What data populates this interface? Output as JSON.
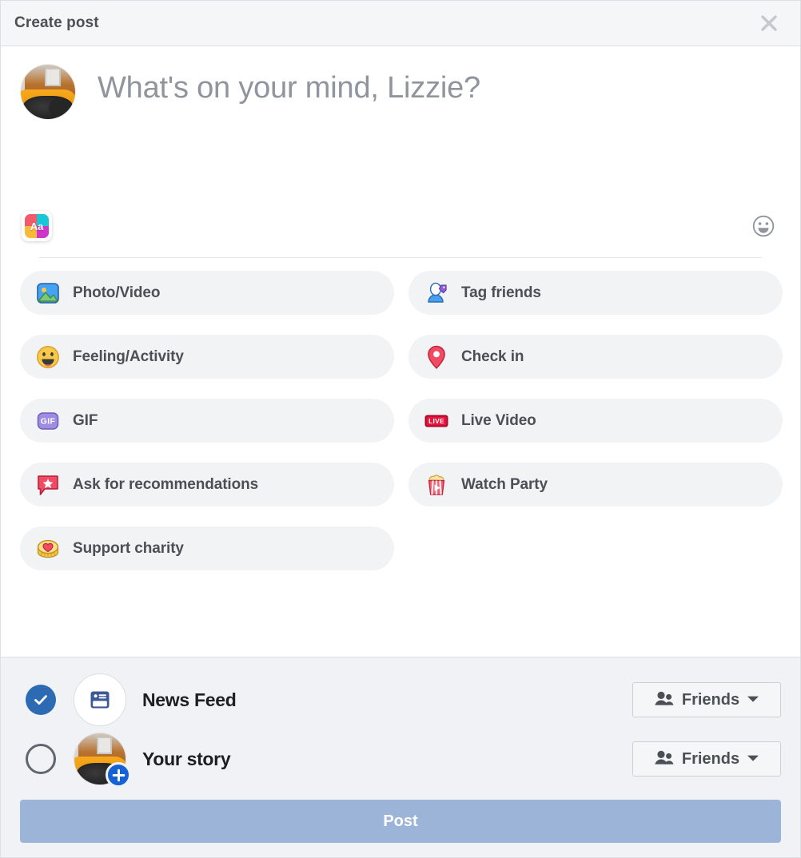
{
  "header": {
    "title": "Create post",
    "close_icon": "close-icon"
  },
  "composer": {
    "placeholder": "What's on your mind, Lizzie?",
    "avatar_alt": "user-avatar",
    "background_picker": {
      "icon": "aa-background-icon",
      "label": "Aa"
    },
    "emoji_button_icon": "smiley-face-icon"
  },
  "options": [
    {
      "id": "photo-video",
      "label": "Photo/Video",
      "icon": "photo-video-icon"
    },
    {
      "id": "tag-friends",
      "label": "Tag friends",
      "icon": "tag-friends-icon"
    },
    {
      "id": "feeling-activity",
      "label": "Feeling/Activity",
      "icon": "feeling-activity-icon"
    },
    {
      "id": "check-in",
      "label": "Check in",
      "icon": "location-pin-icon"
    },
    {
      "id": "gif",
      "label": "GIF",
      "icon": "gif-icon"
    },
    {
      "id": "live-video",
      "label": "Live Video",
      "icon": "live-video-icon"
    },
    {
      "id": "recommendations",
      "label": "Ask for recommendations",
      "icon": "recommendations-icon"
    },
    {
      "id": "watch-party",
      "label": "Watch Party",
      "icon": "watch-party-icon"
    },
    {
      "id": "support-charity",
      "label": "Support charity",
      "icon": "charity-coin-icon"
    }
  ],
  "destinations": [
    {
      "id": "news-feed",
      "label": "News Feed",
      "selected": true,
      "icon": "news-feed-icon",
      "audience": {
        "label": "Friends",
        "icon": "friends-icon",
        "chevron": "chevron-down-icon"
      }
    },
    {
      "id": "your-story",
      "label": "Your story",
      "selected": false,
      "icon": "user-avatar-with-plus",
      "audience": {
        "label": "Friends",
        "icon": "friends-icon",
        "chevron": "chevron-down-icon"
      }
    }
  ],
  "post_button": {
    "label": "Post",
    "enabled": false,
    "color": "#9cb4d8"
  },
  "colors": {
    "header_bg": "#f5f6f7",
    "footer_bg": "#f0f2f5",
    "option_bg": "#f2f3f5",
    "accent_blue": "#1562d4",
    "selected_blue": "#2d6ab4",
    "text_dark": "#1c1e21",
    "text_muted": "#4b4f56",
    "placeholder_gray": "#90949c"
  }
}
